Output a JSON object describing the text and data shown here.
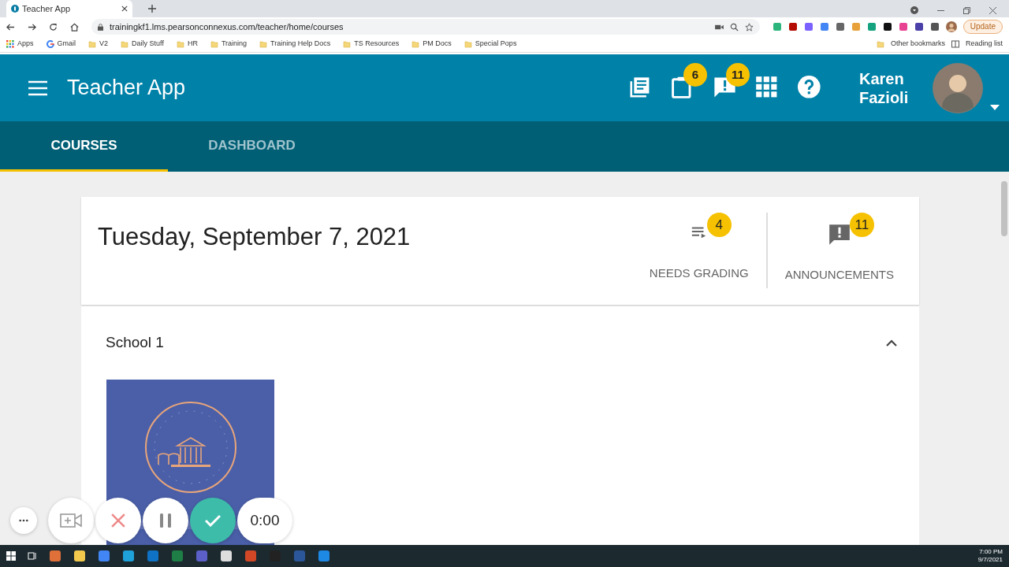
{
  "browser": {
    "tabs": [
      {
        "title": "Teacher App",
        "selected": true
      }
    ],
    "url": "trainingkf1.lms.pearsonconnexus.com/teacher/home/courses",
    "update_button": "Update",
    "bookmarks": [
      {
        "label": "Apps",
        "kind": "apps"
      },
      {
        "label": "Gmail",
        "kind": "google"
      },
      {
        "label": "V2",
        "kind": "folder"
      },
      {
        "label": "Daily Stuff",
        "kind": "folder"
      },
      {
        "label": "HR",
        "kind": "folder"
      },
      {
        "label": "Training",
        "kind": "folder"
      },
      {
        "label": "Training Help Docs",
        "kind": "folder"
      },
      {
        "label": "TS Resources",
        "kind": "folder"
      },
      {
        "label": "PM Docs",
        "kind": "folder"
      },
      {
        "label": "Special Pops",
        "kind": "folder"
      }
    ],
    "other_bookmarks": "Other bookmarks",
    "reading_list": "Reading list"
  },
  "header": {
    "title": "Teacher App",
    "icons": [
      {
        "kind": "library"
      },
      {
        "kind": "clipboard",
        "badge": "6"
      },
      {
        "kind": "announcement",
        "badge": "11"
      },
      {
        "kind": "apps"
      },
      {
        "kind": "help"
      }
    ],
    "user_name": "Karen Fazioli"
  },
  "tabs": [
    {
      "label": "COURSES",
      "selected": true
    },
    {
      "label": "DASHBOARD",
      "selected": false
    }
  ],
  "summary": {
    "date": "Tuesday, September 7, 2021",
    "counters": [
      {
        "kind": "grading",
        "badge": "4",
        "label": "NEEDS GRADING"
      },
      {
        "kind": "announcement",
        "badge": "11",
        "label": "ANNOUNCEMENTS"
      }
    ]
  },
  "schools": [
    {
      "name": "School 1",
      "expanded": true
    }
  ],
  "recorder": {
    "timer": "0:00"
  },
  "taskbar": {
    "time": "7:00 PM",
    "date": "9/7/2021"
  }
}
